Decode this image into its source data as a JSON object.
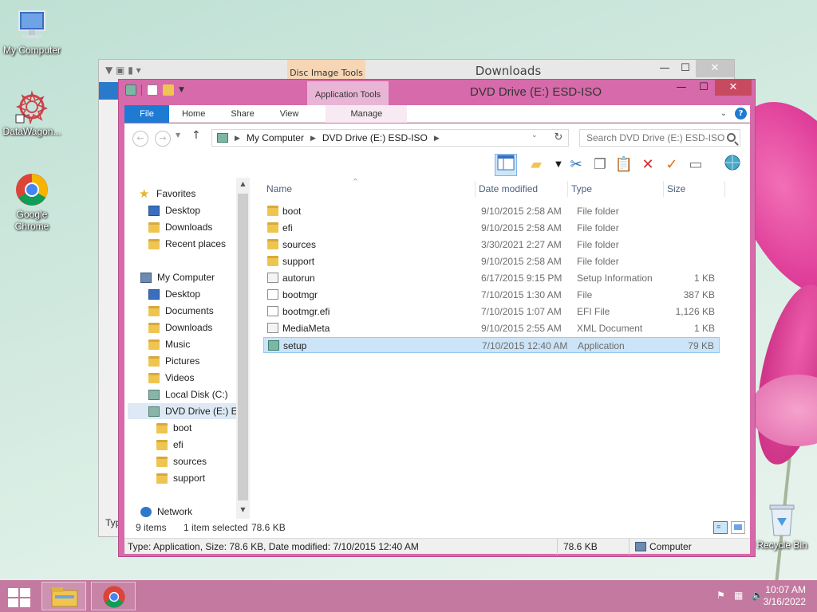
{
  "desktop": {
    "icons": [
      {
        "label": "My Computer"
      },
      {
        "label": "DataWagon..."
      },
      {
        "label": "Google Chrome"
      }
    ],
    "recycle_bin": "Recycle Bin"
  },
  "back_window": {
    "title": "Downloads",
    "context_tab": "Disc Image Tools",
    "minimize": "—",
    "maximize": "☐",
    "close": "✕"
  },
  "window": {
    "title": "DVD Drive (E:) ESD-ISO",
    "context_tab": "Application Tools",
    "minimize": "—",
    "maximize": "☐",
    "close": "✕",
    "ribbon_tabs": {
      "file": "File",
      "home": "Home",
      "share": "Share",
      "view": "View",
      "manage": "Manage"
    },
    "help": "?",
    "address": {
      "crumbs": [
        "My Computer",
        "DVD Drive (E:) ESD-ISO"
      ],
      "search_placeholder": "Search DVD Drive (E:) ESD-ISO"
    },
    "nav": {
      "favorites": "Favorites",
      "fav_items": [
        "Desktop",
        "Downloads",
        "Recent places"
      ],
      "my_computer": "My Computer",
      "pc_items": [
        "Desktop",
        "Documents",
        "Downloads",
        "Music",
        "Pictures",
        "Videos",
        "Local Disk (C:)"
      ],
      "dvd": "DVD Drive (E:) ES",
      "dvd_items": [
        "boot",
        "efi",
        "sources",
        "support"
      ],
      "network": "Network"
    },
    "columns": {
      "name": "Name",
      "date": "Date modified",
      "type": "Type",
      "size": "Size"
    },
    "files": [
      {
        "name": "boot",
        "date": "9/10/2015 2:58 AM",
        "type": "File folder",
        "size": "",
        "icon": "folder-icon"
      },
      {
        "name": "efi",
        "date": "9/10/2015 2:58 AM",
        "type": "File folder",
        "size": "",
        "icon": "folder-icon"
      },
      {
        "name": "sources",
        "date": "3/30/2021 2:27 AM",
        "type": "File folder",
        "size": "",
        "icon": "folder-icon"
      },
      {
        "name": "support",
        "date": "9/10/2015 2:58 AM",
        "type": "File folder",
        "size": "",
        "icon": "folder-icon"
      },
      {
        "name": "autorun",
        "date": "6/17/2015 9:15 PM",
        "type": "Setup Information",
        "size": "1 KB",
        "icon": "setup-info-icon"
      },
      {
        "name": "bootmgr",
        "date": "7/10/2015 1:30 AM",
        "type": "File",
        "size": "387 KB",
        "icon": "file-icon"
      },
      {
        "name": "bootmgr.efi",
        "date": "7/10/2015 1:07 AM",
        "type": "EFI File",
        "size": "1,126 KB",
        "icon": "file-icon"
      },
      {
        "name": "MediaMeta",
        "date": "9/10/2015 2:55 AM",
        "type": "XML Document",
        "size": "1 KB",
        "icon": "xml-icon"
      },
      {
        "name": "setup",
        "date": "7/10/2015 12:40 AM",
        "type": "Application",
        "size": "79 KB",
        "icon": "application-icon"
      }
    ],
    "status": {
      "items": "9 items",
      "selected": "1 item selected",
      "selected_size": "78.6 KB"
    },
    "details": {
      "info": "Type: Application, Size: 78.6 KB, Date modified: 7/10/2015 12:40 AM",
      "size": "78.6 KB",
      "location": "Computer"
    }
  },
  "back_window_partial": {
    "status_left": "Typ"
  },
  "taskbar": {
    "time": "10:07 AM",
    "date": "3/16/2022"
  }
}
